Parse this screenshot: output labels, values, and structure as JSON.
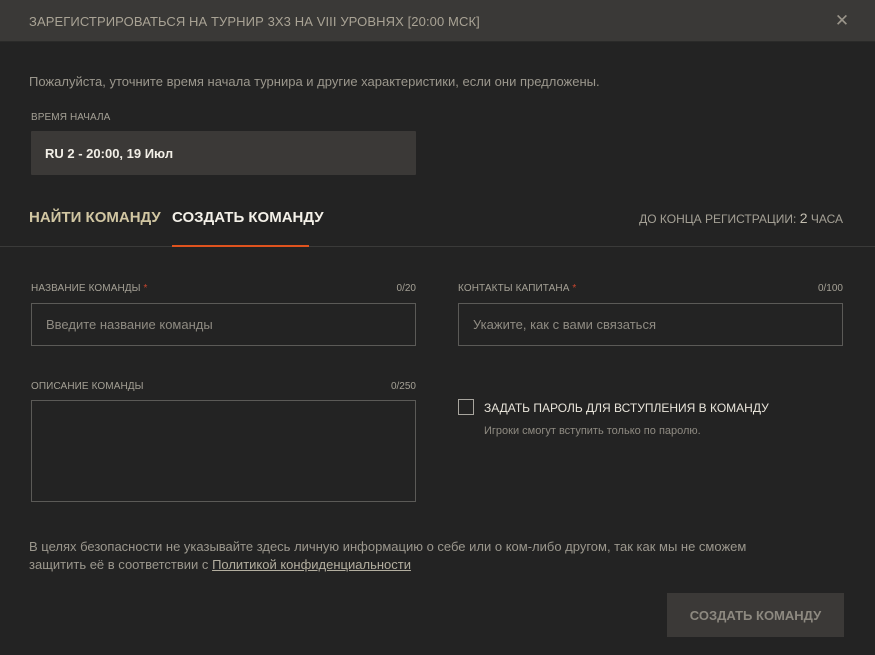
{
  "header": {
    "title": "ЗАРЕГИСТРИРОВАТЬСЯ НА ТУРНИР 3Х3 НА VIII УРОВНЯХ [20:00 МСК]",
    "close_symbol": "✕"
  },
  "intro": "Пожалуйста, уточните время начала турнира и другие характеристики, если они предложены.",
  "start_time": {
    "label": "ВРЕМЯ НАЧАЛА",
    "value": "RU 2 - 20:00, 19 Июл"
  },
  "tabs": [
    {
      "label": "НАЙТИ КОМАНДУ",
      "active": false
    },
    {
      "label": "СОЗДАТЬ КОМАНДУ",
      "active": true
    }
  ],
  "deadline": {
    "prefix": "ДО КОНЦА РЕГИСТРАЦИИ:",
    "number": "2",
    "unit": "ЧАСА"
  },
  "form": {
    "team_name": {
      "label": "НАЗВАНИЕ КОМАНДЫ",
      "required_mark": "*",
      "counter": "0/20",
      "placeholder": "Введите название команды",
      "value": ""
    },
    "captain_contacts": {
      "label": "КОНТАКТЫ КАПИТАНА",
      "required_mark": "*",
      "counter": "0/100",
      "placeholder": "Укажите, как с вами связаться",
      "value": ""
    },
    "team_description": {
      "label": "ОПИСАНИЕ КОМАНДЫ",
      "counter": "0/250",
      "value": ""
    },
    "password_option": {
      "label": "ЗАДАТЬ ПАРОЛЬ ДЛЯ ВСТУПЛЕНИЯ В КОМАНДУ",
      "hint": "Игроки смогут вступить только по паролю.",
      "checked": false
    }
  },
  "warning": {
    "text": "В целях безопасности не указывайте здесь личную информацию о себе или о ком-либо другом, так как мы не сможем защитить её в соответствии с",
    "link": "Политикой конфиденциальности"
  },
  "submit_label": "СОЗДАТЬ КОМАНДУ",
  "colors": {
    "accent": "#e0531e",
    "required": "#c8452e",
    "background": "#232323",
    "header_bg": "#3a3937"
  }
}
